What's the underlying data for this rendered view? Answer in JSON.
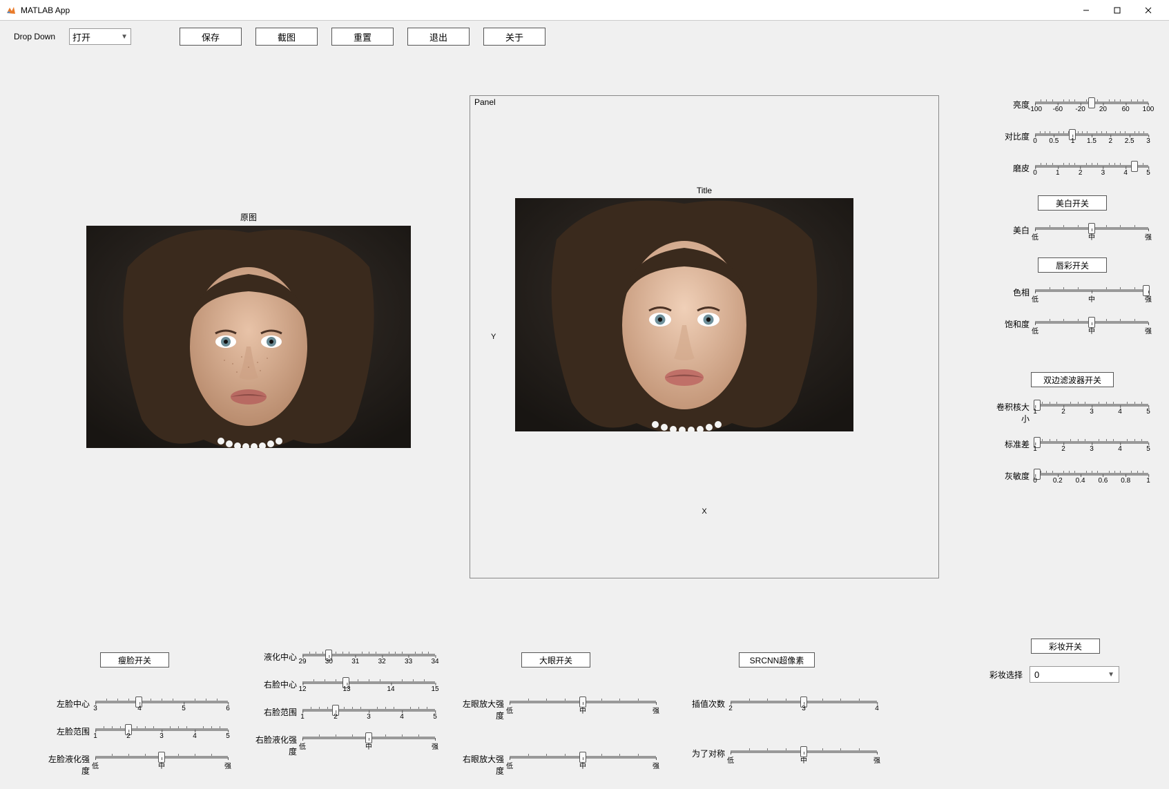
{
  "window": {
    "title": "MATLAB App"
  },
  "toolbar": {
    "dropdown_label": "Drop Down",
    "dropdown_value": "打开",
    "save": "保存",
    "screenshot": "截图",
    "reset": "重置",
    "exit": "退出",
    "about": "关于"
  },
  "orig": {
    "title": "原图"
  },
  "panel": {
    "label": "Panel",
    "title": "Title",
    "x": "X",
    "y": "Y"
  },
  "sliders": {
    "brightness": {
      "label": "亮度",
      "ticks": [
        "-100",
        "-60",
        "-20",
        "20",
        "60",
        "100"
      ],
      "pos": 50
    },
    "contrast": {
      "label": "对比度",
      "ticks": [
        "0",
        "0.5",
        "1",
        "1.5",
        "2",
        "2.5",
        "3"
      ],
      "pos": 33
    },
    "smooth": {
      "label": "磨皮",
      "ticks": [
        "0",
        "1",
        "2",
        "3",
        "4",
        "5"
      ],
      "pos": 88
    },
    "whiten": {
      "label": "美白",
      "ticks": [
        "低",
        "中",
        "强"
      ],
      "pos": 50
    },
    "hue": {
      "label": "色相",
      "ticks": [
        "低",
        "中",
        "强"
      ],
      "pos": 98
    },
    "saturation": {
      "label": "饱和度",
      "ticks": [
        "低",
        "中",
        "强"
      ],
      "pos": 50
    },
    "kernel": {
      "label": "卷积核大小",
      "ticks": [
        "1",
        "2",
        "3",
        "4",
        "5"
      ],
      "pos": 2
    },
    "stddev": {
      "label": "标准差",
      "ticks": [
        "1",
        "2",
        "3",
        "4",
        "5"
      ],
      "pos": 2
    },
    "graysens": {
      "label": "灰敏度",
      "ticks": [
        "0",
        "0.2",
        "0.4",
        "0.6",
        "0.8",
        "1"
      ],
      "pos": 2
    },
    "left_center": {
      "label": "左脸中心",
      "ticks": [
        "3",
        "4",
        "5",
        "6"
      ],
      "pos": 33
    },
    "left_range": {
      "label": "左脸范围",
      "ticks": [
        "1",
        "2",
        "3",
        "4",
        "5"
      ],
      "pos": 25
    },
    "left_liq": {
      "label": "左脸液化强度",
      "ticks": [
        "低",
        "中",
        "强"
      ],
      "pos": 50
    },
    "liq_center": {
      "label": "液化中心",
      "ticks": [
        "29",
        "30",
        "31",
        "32",
        "33",
        "34"
      ],
      "pos": 20
    },
    "right_center": {
      "label": "右脸中心",
      "ticks": [
        "12",
        "13",
        "14",
        "15"
      ],
      "pos": 33
    },
    "right_range": {
      "label": "右脸范围",
      "ticks": [
        "1",
        "2",
        "3",
        "4",
        "5"
      ],
      "pos": 25
    },
    "right_liq": {
      "label": "右脸液化强度",
      "ticks": [
        "低",
        "中",
        "强"
      ],
      "pos": 50
    },
    "left_eye": {
      "label": "左眼放大强度",
      "ticks": [
        "低",
        "中",
        "强"
      ],
      "pos": 50
    },
    "right_eye": {
      "label": "右眼放大强度",
      "ticks": [
        "低",
        "中",
        "强"
      ],
      "pos": 50
    },
    "interp": {
      "label": "插值次数",
      "ticks": [
        "2",
        "3",
        "4"
      ],
      "pos": 50
    },
    "symmetry": {
      "label": "为了对称",
      "ticks": [
        "低",
        "中",
        "强"
      ],
      "pos": 50
    }
  },
  "buttons": {
    "whiten_switch": "美白开关",
    "lipcolor_switch": "唇彩开关",
    "bilateral_switch": "双边滤波器开关",
    "slimface_switch": "瘦脸开关",
    "bigeye_switch": "大眼开关",
    "srcnn": "SRCNN超像素",
    "makeup_switch": "彩妆开关"
  },
  "makeup": {
    "label": "彩妆选择",
    "value": "0"
  }
}
